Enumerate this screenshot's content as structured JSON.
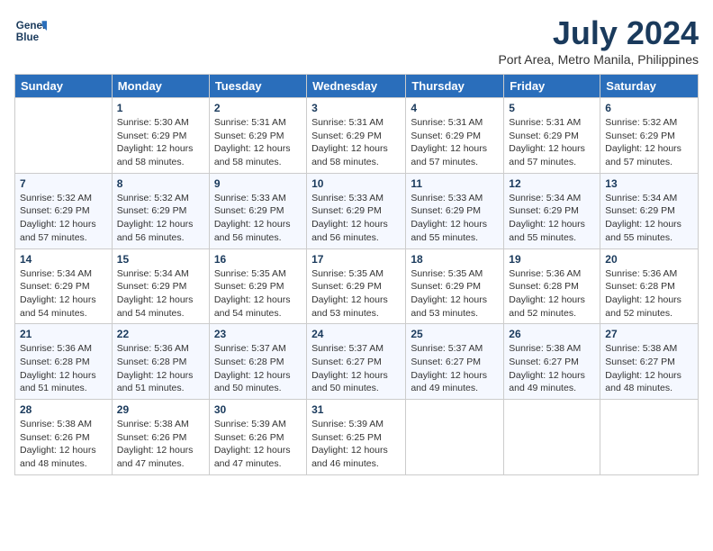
{
  "logo": {
    "line1": "General",
    "line2": "Blue"
  },
  "title": "July 2024",
  "location": "Port Area, Metro Manila, Philippines",
  "days_of_week": [
    "Sunday",
    "Monday",
    "Tuesday",
    "Wednesday",
    "Thursday",
    "Friday",
    "Saturday"
  ],
  "weeks": [
    [
      {
        "day": "",
        "sunrise": "",
        "sunset": "",
        "daylight": ""
      },
      {
        "day": "1",
        "sunrise": "Sunrise: 5:30 AM",
        "sunset": "Sunset: 6:29 PM",
        "daylight": "Daylight: 12 hours and 58 minutes."
      },
      {
        "day": "2",
        "sunrise": "Sunrise: 5:31 AM",
        "sunset": "Sunset: 6:29 PM",
        "daylight": "Daylight: 12 hours and 58 minutes."
      },
      {
        "day": "3",
        "sunrise": "Sunrise: 5:31 AM",
        "sunset": "Sunset: 6:29 PM",
        "daylight": "Daylight: 12 hours and 58 minutes."
      },
      {
        "day": "4",
        "sunrise": "Sunrise: 5:31 AM",
        "sunset": "Sunset: 6:29 PM",
        "daylight": "Daylight: 12 hours and 57 minutes."
      },
      {
        "day": "5",
        "sunrise": "Sunrise: 5:31 AM",
        "sunset": "Sunset: 6:29 PM",
        "daylight": "Daylight: 12 hours and 57 minutes."
      },
      {
        "day": "6",
        "sunrise": "Sunrise: 5:32 AM",
        "sunset": "Sunset: 6:29 PM",
        "daylight": "Daylight: 12 hours and 57 minutes."
      }
    ],
    [
      {
        "day": "7",
        "sunrise": "Sunrise: 5:32 AM",
        "sunset": "Sunset: 6:29 PM",
        "daylight": "Daylight: 12 hours and 57 minutes."
      },
      {
        "day": "8",
        "sunrise": "Sunrise: 5:32 AM",
        "sunset": "Sunset: 6:29 PM",
        "daylight": "Daylight: 12 hours and 56 minutes."
      },
      {
        "day": "9",
        "sunrise": "Sunrise: 5:33 AM",
        "sunset": "Sunset: 6:29 PM",
        "daylight": "Daylight: 12 hours and 56 minutes."
      },
      {
        "day": "10",
        "sunrise": "Sunrise: 5:33 AM",
        "sunset": "Sunset: 6:29 PM",
        "daylight": "Daylight: 12 hours and 56 minutes."
      },
      {
        "day": "11",
        "sunrise": "Sunrise: 5:33 AM",
        "sunset": "Sunset: 6:29 PM",
        "daylight": "Daylight: 12 hours and 55 minutes."
      },
      {
        "day": "12",
        "sunrise": "Sunrise: 5:34 AM",
        "sunset": "Sunset: 6:29 PM",
        "daylight": "Daylight: 12 hours and 55 minutes."
      },
      {
        "day": "13",
        "sunrise": "Sunrise: 5:34 AM",
        "sunset": "Sunset: 6:29 PM",
        "daylight": "Daylight: 12 hours and 55 minutes."
      }
    ],
    [
      {
        "day": "14",
        "sunrise": "Sunrise: 5:34 AM",
        "sunset": "Sunset: 6:29 PM",
        "daylight": "Daylight: 12 hours and 54 minutes."
      },
      {
        "day": "15",
        "sunrise": "Sunrise: 5:34 AM",
        "sunset": "Sunset: 6:29 PM",
        "daylight": "Daylight: 12 hours and 54 minutes."
      },
      {
        "day": "16",
        "sunrise": "Sunrise: 5:35 AM",
        "sunset": "Sunset: 6:29 PM",
        "daylight": "Daylight: 12 hours and 54 minutes."
      },
      {
        "day": "17",
        "sunrise": "Sunrise: 5:35 AM",
        "sunset": "Sunset: 6:29 PM",
        "daylight": "Daylight: 12 hours and 53 minutes."
      },
      {
        "day": "18",
        "sunrise": "Sunrise: 5:35 AM",
        "sunset": "Sunset: 6:29 PM",
        "daylight": "Daylight: 12 hours and 53 minutes."
      },
      {
        "day": "19",
        "sunrise": "Sunrise: 5:36 AM",
        "sunset": "Sunset: 6:28 PM",
        "daylight": "Daylight: 12 hours and 52 minutes."
      },
      {
        "day": "20",
        "sunrise": "Sunrise: 5:36 AM",
        "sunset": "Sunset: 6:28 PM",
        "daylight": "Daylight: 12 hours and 52 minutes."
      }
    ],
    [
      {
        "day": "21",
        "sunrise": "Sunrise: 5:36 AM",
        "sunset": "Sunset: 6:28 PM",
        "daylight": "Daylight: 12 hours and 51 minutes."
      },
      {
        "day": "22",
        "sunrise": "Sunrise: 5:36 AM",
        "sunset": "Sunset: 6:28 PM",
        "daylight": "Daylight: 12 hours and 51 minutes."
      },
      {
        "day": "23",
        "sunrise": "Sunrise: 5:37 AM",
        "sunset": "Sunset: 6:28 PM",
        "daylight": "Daylight: 12 hours and 50 minutes."
      },
      {
        "day": "24",
        "sunrise": "Sunrise: 5:37 AM",
        "sunset": "Sunset: 6:27 PM",
        "daylight": "Daylight: 12 hours and 50 minutes."
      },
      {
        "day": "25",
        "sunrise": "Sunrise: 5:37 AM",
        "sunset": "Sunset: 6:27 PM",
        "daylight": "Daylight: 12 hours and 49 minutes."
      },
      {
        "day": "26",
        "sunrise": "Sunrise: 5:38 AM",
        "sunset": "Sunset: 6:27 PM",
        "daylight": "Daylight: 12 hours and 49 minutes."
      },
      {
        "day": "27",
        "sunrise": "Sunrise: 5:38 AM",
        "sunset": "Sunset: 6:27 PM",
        "daylight": "Daylight: 12 hours and 48 minutes."
      }
    ],
    [
      {
        "day": "28",
        "sunrise": "Sunrise: 5:38 AM",
        "sunset": "Sunset: 6:26 PM",
        "daylight": "Daylight: 12 hours and 48 minutes."
      },
      {
        "day": "29",
        "sunrise": "Sunrise: 5:38 AM",
        "sunset": "Sunset: 6:26 PM",
        "daylight": "Daylight: 12 hours and 47 minutes."
      },
      {
        "day": "30",
        "sunrise": "Sunrise: 5:39 AM",
        "sunset": "Sunset: 6:26 PM",
        "daylight": "Daylight: 12 hours and 47 minutes."
      },
      {
        "day": "31",
        "sunrise": "Sunrise: 5:39 AM",
        "sunset": "Sunset: 6:25 PM",
        "daylight": "Daylight: 12 hours and 46 minutes."
      },
      {
        "day": "",
        "sunrise": "",
        "sunset": "",
        "daylight": ""
      },
      {
        "day": "",
        "sunrise": "",
        "sunset": "",
        "daylight": ""
      },
      {
        "day": "",
        "sunrise": "",
        "sunset": "",
        "daylight": ""
      }
    ]
  ]
}
